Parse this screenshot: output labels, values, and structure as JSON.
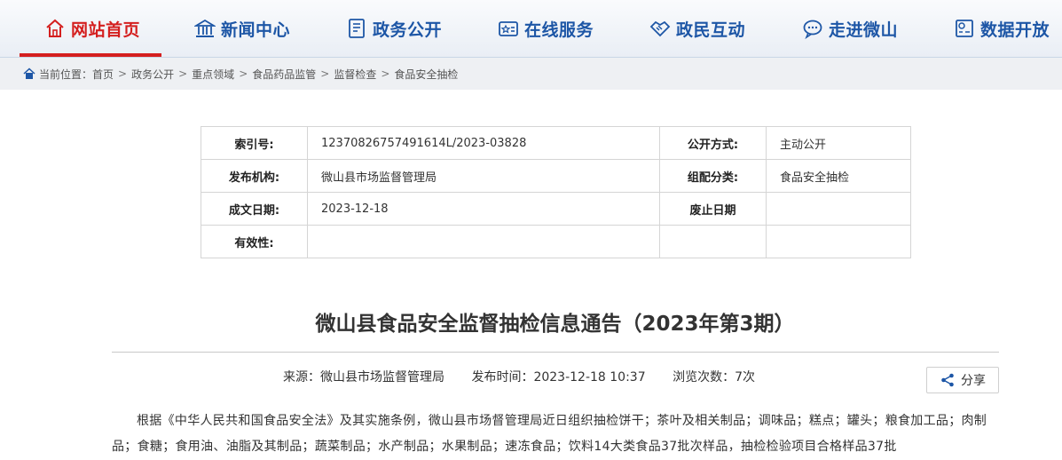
{
  "nav": {
    "items": [
      {
        "label": "网站首页",
        "icon": "home-icon"
      },
      {
        "label": "新闻中心",
        "icon": "building-icon"
      },
      {
        "label": "政务公开",
        "icon": "document-icon"
      },
      {
        "label": "在线服务",
        "icon": "star-card-icon"
      },
      {
        "label": "政民互动",
        "icon": "handshake-icon"
      },
      {
        "label": "走进微山",
        "icon": "chat-icon"
      },
      {
        "label": "数据开放",
        "icon": "data-icon"
      }
    ],
    "active_index": 0,
    "colors": {
      "active": "#d41f1f",
      "normal": "#1d56a6"
    }
  },
  "breadcrumb": {
    "prefix": "当前位置：",
    "items": [
      "首页",
      "政务公开",
      "重点领域",
      "食品药品监管",
      "监督检查",
      "食品安全抽检"
    ],
    "separator": ">"
  },
  "info": {
    "index_label": "索引号:",
    "index_value": "12370826757491614L/2023-03828",
    "open_label": "公开方式:",
    "open_value": "主动公开",
    "issuer_label": "发布机构:",
    "issuer_value": "微山县市场监督管理局",
    "category_label": "组配分类:",
    "category_value": "食品安全抽检",
    "date_label": "成文日期:",
    "date_value": "2023-12-18",
    "abolish_label": "废止日期",
    "abolish_value": "",
    "validity_label": "有效性:",
    "validity_value": ""
  },
  "article": {
    "title": "微山县食品安全监督抽检信息通告（2023年第3期）",
    "source": "来源：微山县市场监督管理局",
    "publish_time": "发布时间：2023-12-18 10:37",
    "views": "浏览次数：7次",
    "share_label": "分享",
    "body": "根据《中华人民共和国食品安全法》及其实施条例，微山县市场督管理局近日组织抽检饼干；茶叶及相关制品；调味品；糕点；罐头；粮食加工品；肉制品；食糖；食用油、油脂及其制品；蔬菜制品；水产制品；水果制品；速冻食品；饮料14大类食品37批次样品，抽检检验项目合格样品37批"
  }
}
